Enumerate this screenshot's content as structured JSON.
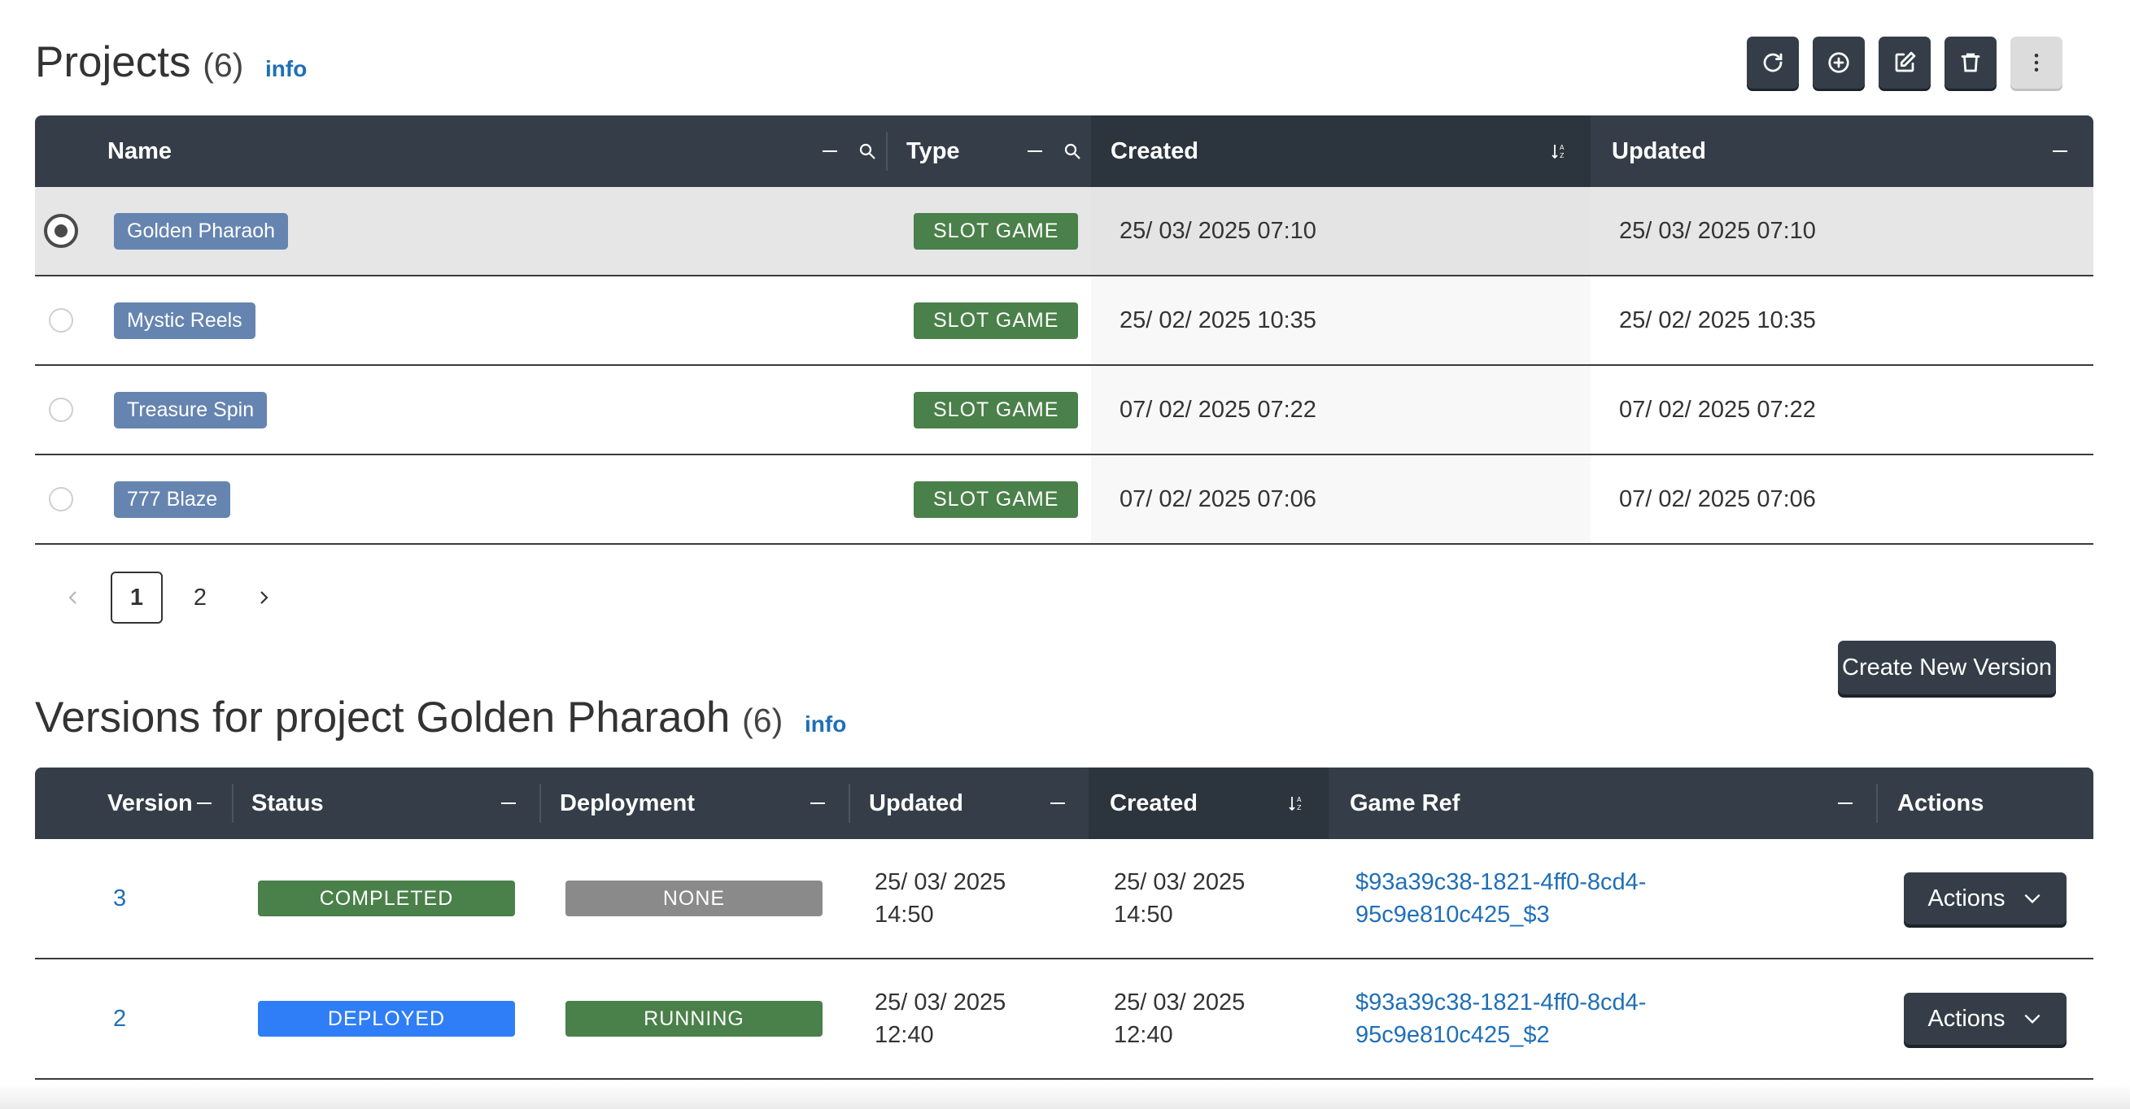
{
  "projects": {
    "title": "Projects",
    "count": "(6)",
    "info": "info",
    "columns": {
      "name": "Name",
      "type": "Type",
      "created": "Created",
      "updated": "Updated"
    },
    "rows": [
      {
        "name": "Golden Pharaoh",
        "type": "SLOT GAME",
        "created": "25/ 03/ 2025 07:10",
        "updated": "25/ 03/ 2025 07:10",
        "selected": true
      },
      {
        "name": "Mystic Reels",
        "type": "SLOT GAME",
        "created": "25/ 02/ 2025 10:35",
        "updated": "25/ 02/ 2025 10:35",
        "selected": false
      },
      {
        "name": "Treasure Spin",
        "type": "SLOT GAME",
        "created": "07/ 02/ 2025 07:22",
        "updated": "07/ 02/ 2025 07:22",
        "selected": false
      },
      {
        "name": "777 Blaze",
        "type": "SLOT GAME",
        "created": "07/ 02/ 2025 07:06",
        "updated": "07/ 02/ 2025 07:06",
        "selected": false
      }
    ],
    "pagination": {
      "pages": [
        "1",
        "2"
      ],
      "current": "1"
    }
  },
  "toolbar": {
    "icons": [
      "refresh-icon",
      "add-circle-icon",
      "edit-icon",
      "trash-icon",
      "more-vertical-icon"
    ]
  },
  "create_version_label": "Create New Version",
  "versions": {
    "title_prefix": "Versions for project Golden Pharaoh",
    "count": "(6)",
    "info": "info",
    "columns": {
      "version": "Version",
      "status": "Status",
      "deployment": "Deployment",
      "updated": "Updated",
      "created": "Created",
      "game_ref": "Game Ref",
      "actions": "Actions"
    },
    "rows": [
      {
        "version": "3",
        "status": "COMPLETED",
        "deployment": "NONE",
        "updated_date": "25/ 03/ 2025",
        "updated_time": "14:50",
        "created_date": "25/ 03/ 2025",
        "created_time": "14:50",
        "ref_line1": "$93a39c38-1821-4ff0-8cd4-",
        "ref_line2": "95c9e810c425_$3",
        "actions": "Actions"
      },
      {
        "version": "2",
        "status": "DEPLOYED",
        "deployment": "RUNNING",
        "updated_date": "25/ 03/ 2025",
        "updated_time": "12:40",
        "created_date": "25/ 03/ 2025",
        "created_time": "12:40",
        "ref_line1": "$93a39c38-1821-4ff0-8cd4-",
        "ref_line2": "95c9e810c425_$2",
        "actions": "Actions"
      }
    ]
  },
  "colors": {
    "header": "#353e48",
    "name_chip": "#6584b0",
    "slot_game": "#4a8049",
    "completed": "#4a8049",
    "deployed": "#2f7ef7",
    "none": "#8a8a8a",
    "running": "#4a8049",
    "link": "#1f6fb8"
  }
}
